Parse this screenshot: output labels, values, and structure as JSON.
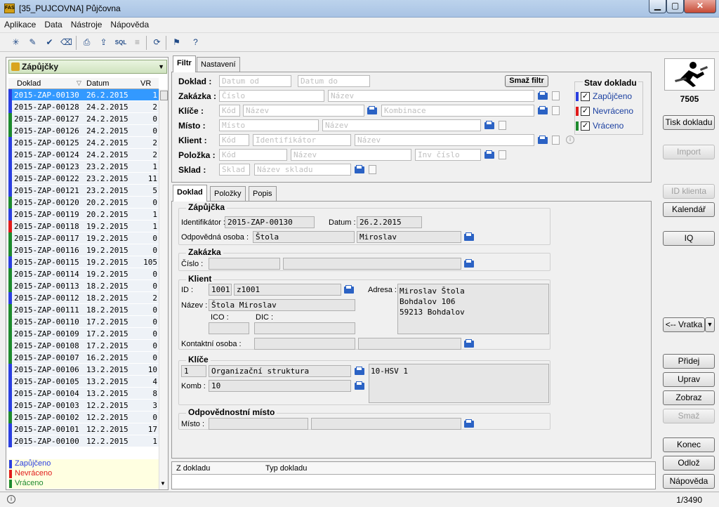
{
  "window": {
    "title": "[35_PUJCOVNA] Půjčovna",
    "app_icon": "FAS"
  },
  "menu": [
    "Aplikace",
    "Data",
    "Nástroje",
    "Nápověda"
  ],
  "toolbar": {
    "sql_label": "SQL"
  },
  "left": {
    "combo": "Zápůjčky",
    "col_doklad": "Doklad",
    "col_datum": "Datum",
    "col_vr": "VR",
    "rows": [
      {
        "doklad": "2015-ZAP-00130",
        "datum": "26.2.2015",
        "vr": "1",
        "status": "blue"
      },
      {
        "doklad": "2015-ZAP-00128",
        "datum": "24.2.2015",
        "vr": "2",
        "status": "blue"
      },
      {
        "doklad": "2015-ZAP-00127",
        "datum": "24.2.2015",
        "vr": "0",
        "status": "green"
      },
      {
        "doklad": "2015-ZAP-00126",
        "datum": "24.2.2015",
        "vr": "0",
        "status": "green"
      },
      {
        "doklad": "2015-ZAP-00125",
        "datum": "24.2.2015",
        "vr": "2",
        "status": "blue"
      },
      {
        "doklad": "2015-ZAP-00124",
        "datum": "24.2.2015",
        "vr": "2",
        "status": "blue"
      },
      {
        "doklad": "2015-ZAP-00123",
        "datum": "23.2.2015",
        "vr": "1",
        "status": "blue"
      },
      {
        "doklad": "2015-ZAP-00122",
        "datum": "23.2.2015",
        "vr": "11",
        "status": "blue"
      },
      {
        "doklad": "2015-ZAP-00121",
        "datum": "23.2.2015",
        "vr": "5",
        "status": "blue"
      },
      {
        "doklad": "2015-ZAP-00120",
        "datum": "20.2.2015",
        "vr": "0",
        "status": "green"
      },
      {
        "doklad": "2015-ZAP-00119",
        "datum": "20.2.2015",
        "vr": "1",
        "status": "blue"
      },
      {
        "doklad": "2015-ZAP-00118",
        "datum": "19.2.2015",
        "vr": "1",
        "status": "red"
      },
      {
        "doklad": "2015-ZAP-00117",
        "datum": "19.2.2015",
        "vr": "0",
        "status": "green"
      },
      {
        "doklad": "2015-ZAP-00116",
        "datum": "19.2.2015",
        "vr": "0",
        "status": "green"
      },
      {
        "doklad": "2015-ZAP-00115",
        "datum": "19.2.2015",
        "vr": "105",
        "status": "blue"
      },
      {
        "doklad": "2015-ZAP-00114",
        "datum": "19.2.2015",
        "vr": "0",
        "status": "green"
      },
      {
        "doklad": "2015-ZAP-00113",
        "datum": "18.2.2015",
        "vr": "0",
        "status": "green"
      },
      {
        "doklad": "2015-ZAP-00112",
        "datum": "18.2.2015",
        "vr": "2",
        "status": "blue"
      },
      {
        "doklad": "2015-ZAP-00111",
        "datum": "18.2.2015",
        "vr": "0",
        "status": "green"
      },
      {
        "doklad": "2015-ZAP-00110",
        "datum": "17.2.2015",
        "vr": "0",
        "status": "green"
      },
      {
        "doklad": "2015-ZAP-00109",
        "datum": "17.2.2015",
        "vr": "0",
        "status": "green"
      },
      {
        "doklad": "2015-ZAP-00108",
        "datum": "17.2.2015",
        "vr": "0",
        "status": "green"
      },
      {
        "doklad": "2015-ZAP-00107",
        "datum": "16.2.2015",
        "vr": "0",
        "status": "green"
      },
      {
        "doklad": "2015-ZAP-00106",
        "datum": "13.2.2015",
        "vr": "10",
        "status": "blue"
      },
      {
        "doklad": "2015-ZAP-00105",
        "datum": "13.2.2015",
        "vr": "4",
        "status": "blue"
      },
      {
        "doklad": "2015-ZAP-00104",
        "datum": "13.2.2015",
        "vr": "8",
        "status": "blue"
      },
      {
        "doklad": "2015-ZAP-00103",
        "datum": "12.2.2015",
        "vr": "3",
        "status": "blue"
      },
      {
        "doklad": "2015-ZAP-00102",
        "datum": "12.2.2015",
        "vr": "0",
        "status": "green"
      },
      {
        "doklad": "2015-ZAP-00101",
        "datum": "12.2.2015",
        "vr": "17",
        "status": "blue"
      },
      {
        "doklad": "2015-ZAP-00100",
        "datum": "12.2.2015",
        "vr": "1",
        "status": "blue"
      }
    ],
    "legend": [
      "Zapůjčeno",
      "Nevráceno",
      "Vráceno"
    ]
  },
  "colors": {
    "blue": "#2b3fe0",
    "red": "#e01b1b",
    "green": "#1e8a2e",
    "selected": "#3399ff"
  },
  "tabs_top": [
    "Filtr",
    "Nastavení"
  ],
  "filter": {
    "doklad_label": "Doklad :",
    "zakazka_label": "Zakázka :",
    "klice_label": "Klíče :",
    "misto_label": "Místo :",
    "klient_label": "Klient :",
    "polozka_label": "Položka :",
    "sklad_label": "Sklad :",
    "ph_datum_od": "Datum od",
    "ph_datum_do": "Datum do",
    "ph_cislo": "Číslo",
    "ph_nazev": "Název",
    "ph_kod": "Kód",
    "ph_kombinace": "Kombinace",
    "ph_misto": "Místo",
    "ph_identifikator": "Identifikátor",
    "ph_inv_cislo": "Inv číslo",
    "ph_sklad": "Sklad",
    "ph_nazev_skladu": "Název skladu",
    "clear_btn": "Smaž filtr",
    "stav_title": "Stav dokladu",
    "stav": [
      "Zapůjčeno",
      "Nevráceno",
      "Vráceno"
    ]
  },
  "tabs_detail": [
    "Doklad",
    "Položky",
    "Popis"
  ],
  "detail": {
    "zapujcka_title": "Zápůjčka",
    "identifikator_label": "Identifikátor :",
    "identifikator": "2015-ZAP-00130",
    "datum_label": "Datum :",
    "datum": "26.2.2015",
    "odp_osoba_label": "Odpovědná osoba :",
    "odp_prijmeni": "Štola",
    "odp_jmeno": "Miroslav",
    "zakazka_title": "Zakázka",
    "cislo_label": "Číslo :",
    "klient_title": "Klient",
    "id_label": "ID :",
    "klient_id": "1001",
    "klient_kod": "z1001",
    "adresa_label": "Adresa :",
    "adresa_line1": "Miroslav Štola",
    "adresa_line2": "Bohdalov 106",
    "adresa_line3": "59213 Bohdalov",
    "nazev_label": "Název :",
    "klient_nazev": "Štola Miroslav",
    "ico_label": "ICO :",
    "dic_label": "DIC :",
    "kontakt_label": "Kontaktní osoba :",
    "klice_title": "Klíče",
    "klic_num": "1",
    "klic_nazev": "Organizační struktura",
    "klic_hodnota": "10-HSV 1",
    "komb_label": "Komb :",
    "komb_value": "10",
    "odp_misto_title": "Odpovědnostní místo",
    "misto_label": "Místo :"
  },
  "bottom_list": {
    "col1": "Z dokladu",
    "col2": "Typ dokladu"
  },
  "right": {
    "number": "7505",
    "tisk": "Tisk dokladu",
    "import": "Import",
    "id_klienta": "ID klienta",
    "kalendar": "Kalendář",
    "iq": "IQ",
    "vratka": "<-- Vratka",
    "pridej": "Přidej",
    "uprav": "Uprav",
    "zobraz": "Zobraz",
    "smaz": "Smaž",
    "konec": "Konec",
    "odloz": "Odlož",
    "napoveda": "Nápověda"
  },
  "status": {
    "record": "1/3490"
  }
}
